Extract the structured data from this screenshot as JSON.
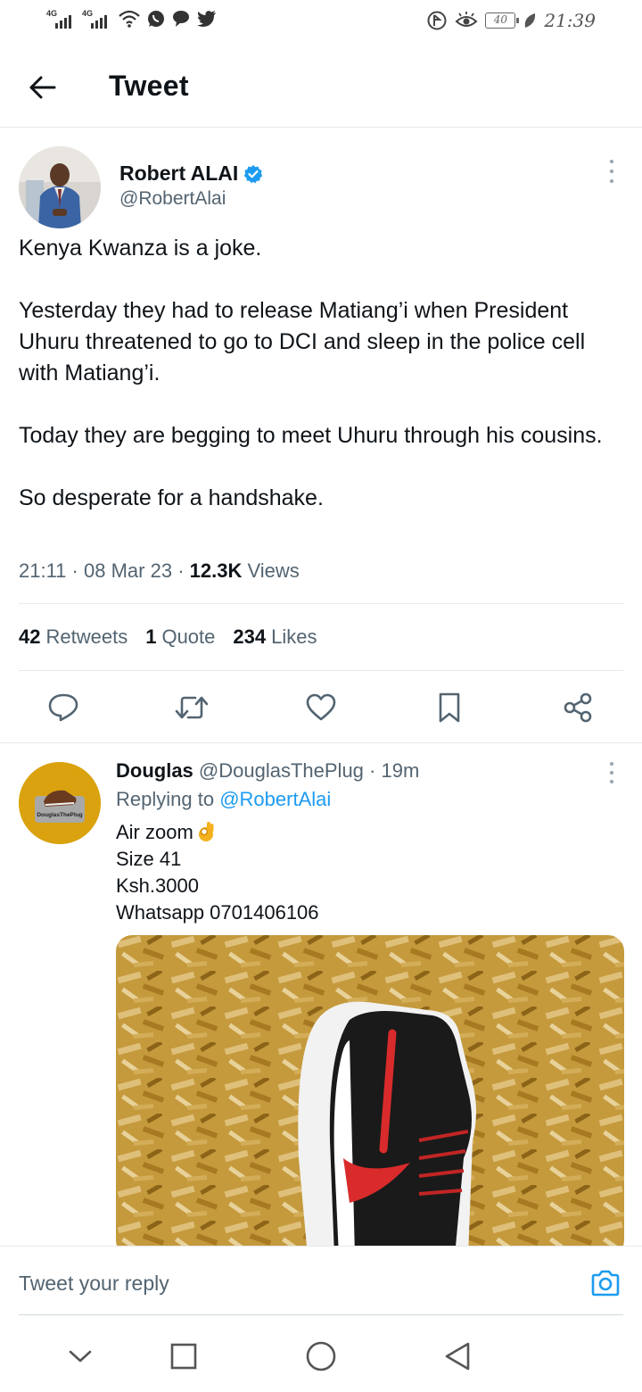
{
  "status_bar": {
    "network_1": "4G",
    "network_2": "4G",
    "battery": "40",
    "time": "21:39"
  },
  "header": {
    "title": "Tweet"
  },
  "tweet": {
    "author_name": "Robert ALAI",
    "author_handle": "@RobertAlai",
    "paragraphs": [
      "Kenya Kwanza is a joke.",
      "Yesterday they had to release Matiang’i when President Uhuru threatened to go to DCI and sleep in the police cell with Matiang’i.",
      "Today they are begging to meet Uhuru through his cousins.",
      "So desperate for a handshake."
    ],
    "time": "21:11",
    "date": "08 Mar 23",
    "views_count": "12.3K",
    "views_label": "Views",
    "retweets_count": "42",
    "retweets_label": "Retweets",
    "quotes_count": "1",
    "quotes_label": "Quote",
    "likes_count": "234",
    "likes_label": "Likes"
  },
  "reply": {
    "author_name": "Douglas",
    "author_handle": "@DouglasThePlug",
    "age": "19m",
    "replying_prefix": "Replying to",
    "replying_to": "@RobertAlai",
    "lines": [
      "Air zoom",
      "Size 41",
      "Ksh.3000",
      "Whatsapp 0701406106"
    ],
    "avatar_text": "DouglasThePlug"
  },
  "reply_bar": {
    "placeholder": "Tweet your reply"
  },
  "colors": {
    "accent": "#1d9bf0",
    "text": "#0f1419",
    "secondary": "#536471",
    "divider": "#e6e9eb"
  }
}
